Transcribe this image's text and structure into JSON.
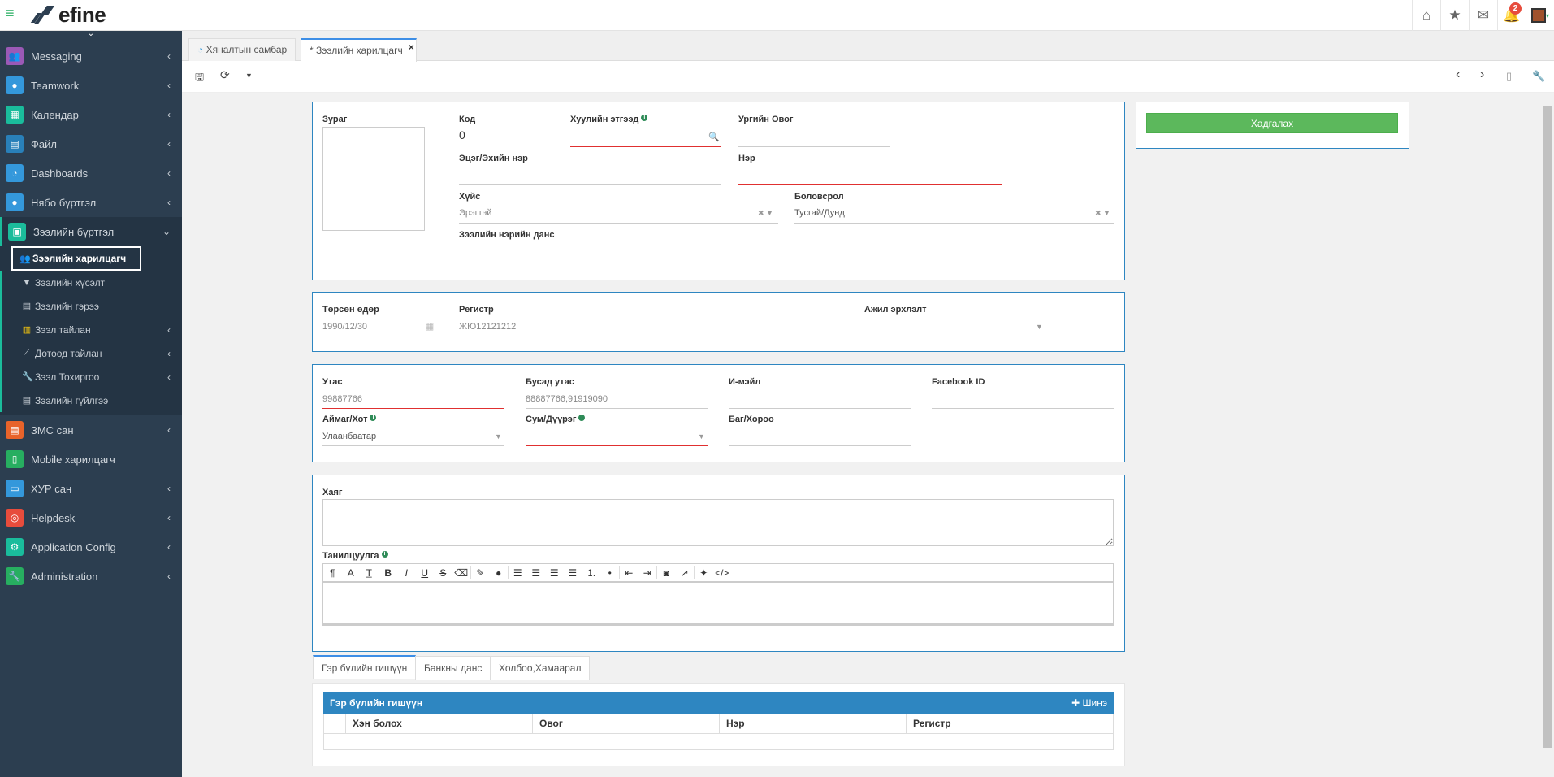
{
  "app": {
    "name": "efine",
    "notification_count": "2"
  },
  "sidebar": {
    "items": [
      {
        "label": "Messaging",
        "color": "#9b59b6"
      },
      {
        "label": "Teamwork",
        "color": "#3498db"
      },
      {
        "label": "Календар",
        "color": "#1abc9c"
      },
      {
        "label": "Файл",
        "color": "#2980b9"
      },
      {
        "label": "Dashboards",
        "color": "#3498db"
      },
      {
        "label": "Нябо бүртгэл",
        "color": "#3498db"
      }
    ],
    "active_group": {
      "label": "Зээлийн бүртгэл",
      "color": "#1bbc9b"
    },
    "sub_items": [
      {
        "label": "Зээлийн харилцагч"
      },
      {
        "label": "Зээлийн хүсэлт"
      },
      {
        "label": "Зээлийн гэрээ"
      },
      {
        "label": "Зээл тайлан"
      },
      {
        "label": "Дотоод тайлан"
      },
      {
        "label": "Зээл Тохиргоо"
      },
      {
        "label": "Зээлийн гүйлгээ"
      }
    ],
    "items_after": [
      {
        "label": "ЗМС сан",
        "color": "#e74c3c"
      },
      {
        "label": "Mobile харилцагч",
        "color": "#27ae60"
      },
      {
        "label": "ХУР сан",
        "color": "#3498db"
      },
      {
        "label": "Helpdesk",
        "color": "#e74c3c"
      },
      {
        "label": "Application Config",
        "color": "#1abc9c"
      },
      {
        "label": "Administration",
        "color": "#27ae60"
      }
    ]
  },
  "tabs": [
    {
      "label": "Хяналтын самбар"
    },
    {
      "label": "* Зээлийн харилцагч"
    }
  ],
  "form": {
    "photo_label": "Зураг",
    "code_label": "Код",
    "code_value": "0",
    "legal_entity_label": "Хуулийн этгээд",
    "family_name_label": "Ургийн Овог",
    "father_name_label": "Эцэг/Эхийн нэр",
    "name_label": "Нэр",
    "gender_label": "Хүйс",
    "gender_value": "Эрэгтэй",
    "education_label": "Боловсрол",
    "education_value": "Тусгай/Дунд",
    "loan_account_label": "Зээлийн нэрийн данс",
    "birth_label": "Төрсөн өдөр",
    "birth_value": "1990/12/30",
    "register_label": "Регистр",
    "register_value": "ЖЮ12121212",
    "job_label": "Ажил эрхлэлт",
    "phone_label": "Утас",
    "phone_value": "99887766",
    "other_phone_label": "Бусад утас",
    "other_phone_value": "88887766,91919090",
    "email_label": "И-мэйл",
    "facebook_label": "Facebook ID",
    "aimag_label": "Аймаг/Хот",
    "aimag_value": "Улаанбаатар",
    "sum_label": "Сум/Дүүрэг",
    "bag_label": "Баг/Хороо",
    "address_label": "Хаяг",
    "intro_label": "Танилцуулга",
    "save_label": "Хадгалах"
  },
  "bottom_tabs": [
    {
      "label": "Гэр бүлийн гишүүн"
    },
    {
      "label": "Банкны данс"
    },
    {
      "label": "Холбоо,Хамаарал"
    }
  ],
  "family_table": {
    "title": "Гэр бүлийн гишүүн",
    "new_label": "Шинэ",
    "columns": [
      "Хэн болох",
      "Овог",
      "Нэр",
      "Регистр"
    ]
  }
}
